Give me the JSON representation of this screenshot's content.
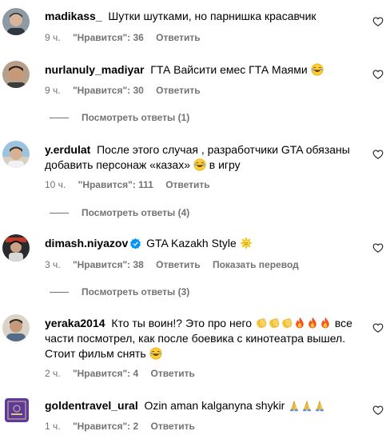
{
  "comments": [
    {
      "user": "madikass_",
      "text": "Шутки шутками, но парнишка красавчик",
      "time": "9 ч.",
      "likes": "\"Нравится\": 36",
      "reply": "Ответить"
    },
    {
      "user": "nurlanuly_madiyar",
      "text": "ГТА Вайсити емес ГТА Маями",
      "time": "9 ч.",
      "likes": "\"Нравится\": 30",
      "reply": "Ответить",
      "view_replies": "Посмотреть ответы (1)"
    },
    {
      "user": "y.erdulat",
      "text_a": "После этого случая , разработчики GTA обязаны добавить персонаж «казах»",
      "text_b": "в игру",
      "time": "10 ч.",
      "likes": "\"Нравится\": 111",
      "reply": "Ответить",
      "view_replies": "Посмотреть ответы (4)"
    },
    {
      "user": "dimash.niyazov",
      "text": "GTA Kazakh Style",
      "time": "3 ч.",
      "likes": "\"Нравится\": 38",
      "reply": "Ответить",
      "translate": "Показать перевод",
      "view_replies": "Посмотреть ответы (3)"
    },
    {
      "user": "yeraka2014",
      "text_a": "Кто ты воин!? Это про него",
      "text_b": "все части посмотрел, как после боевика с кинотеатра вышел. Стоит фильм снять",
      "time": "2 ч.",
      "likes": "\"Нравится\": 4",
      "reply": "Ответить"
    },
    {
      "user": "goldentravel_ural",
      "text": "Ozin aman kalganyna shykir",
      "time": "1 ч.",
      "likes": "\"Нравится\": 2",
      "reply": "Ответить"
    }
  ],
  "colors": {
    "meta": "#737373",
    "verified": "#0095f6"
  },
  "icons": {
    "like": "heart-outline-icon",
    "verified": "verified-badge-icon"
  }
}
